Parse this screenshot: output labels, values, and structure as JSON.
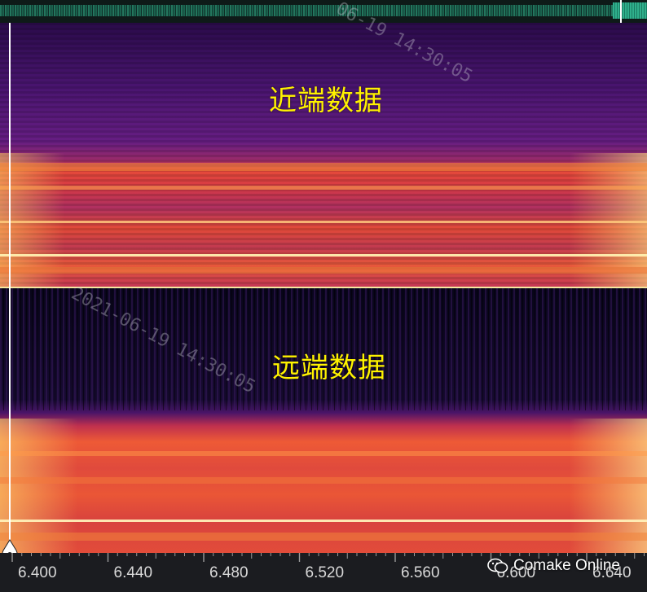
{
  "overview": {
    "icon": "waveform-overview"
  },
  "near_panel": {
    "label": "近端数据"
  },
  "far_panel": {
    "label": "远端数据"
  },
  "watermarks": [
    {
      "text": "06-19 14:30:05"
    },
    {
      "text": "2021-06-19 14:30:05"
    }
  ],
  "ruler": {
    "ticks": [
      {
        "label": "6.400"
      },
      {
        "label": "6.440"
      },
      {
        "label": "6.480"
      },
      {
        "label": "6.520"
      },
      {
        "label": "6.560"
      },
      {
        "label": "6.600"
      },
      {
        "label": "6.640"
      }
    ]
  },
  "brand": {
    "text": "Comake Online",
    "icon": "wechat-icon"
  },
  "colors": {
    "label": "#fff200",
    "divider": "#f5e8a0",
    "ruler_bg": "#1b1c20",
    "waveform": "#2fb08c"
  }
}
